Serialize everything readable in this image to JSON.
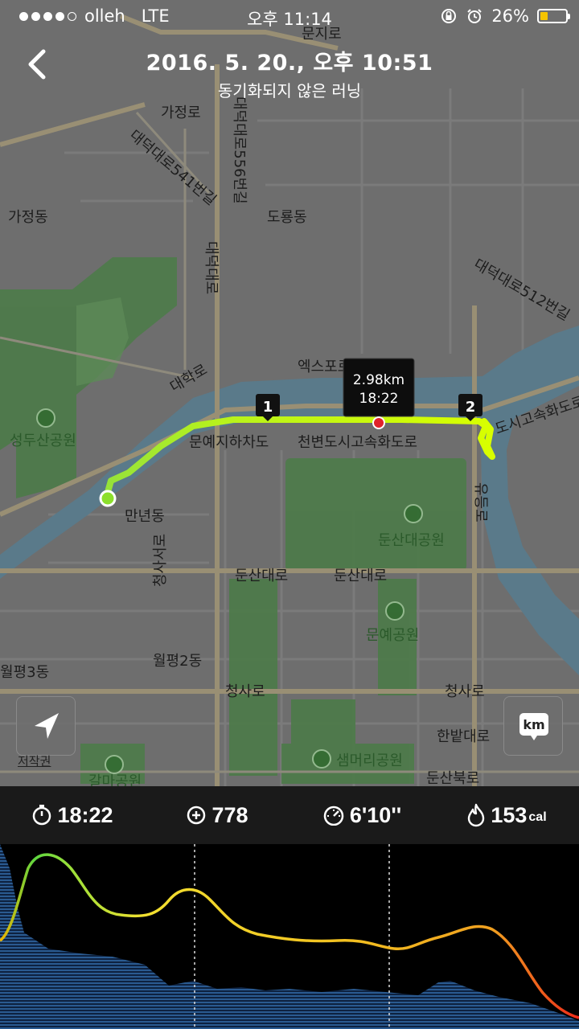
{
  "status_bar": {
    "carrier": "olleh",
    "network": "LTE",
    "time": "오후 11:14",
    "battery_percent": "26%",
    "signal_bars_filled": 4,
    "signal_bars_total": 5
  },
  "header": {
    "title": "2016. 5. 20., 오후 10:51",
    "subtitle": "동기화되지 않은 러닝"
  },
  "map": {
    "labels": {
      "munji": "문지로",
      "gajeong_ro": "가정로",
      "daedeok_556": "대덕대로556번길",
      "daedeok_541": "대덕대로541번길",
      "gajeong_dong": "가정동",
      "doryong_dong": "도룡동",
      "daedeok_ro": "대덕대로",
      "daedeok_512": "대덕대로512번길",
      "daehak_ro": "대학로",
      "expo": "엑스포로",
      "seongdusan": "성두산공원",
      "munye_underpass": "문예지하차도",
      "cheonbyeon": "천변도시고속화도로",
      "highway_right": "도시고속화도로",
      "mannyeon": "만년동",
      "dunsan_park": "둔산대공원",
      "yudeung": "유등로",
      "dunsan_ro_1": "둔산대로",
      "dunsan_ro_2": "둔산대로",
      "cheongsaseo": "청사서로",
      "munye_park": "문예공원",
      "wolpyeong3": "월평3동",
      "wolpyeong2": "월평2동",
      "cheongsa_ro_1": "청사로",
      "cheongsa_ro_2": "청사로",
      "hanbat": "한밭대로",
      "saemmeori": "샘머리공원",
      "dunsanbuk": "둔산북로",
      "galma": "갈마공원",
      "top_right": "문지로"
    },
    "markers": {
      "lap1": "1",
      "lap2": "2",
      "callout_distance": "2.98km",
      "callout_time": "18:22"
    },
    "copyright": "저작권",
    "unit_toggle": "km"
  },
  "stats": {
    "duration": "18:22",
    "elevation": "778",
    "pace": "6'10''",
    "calories": "153",
    "calories_unit": "cal"
  },
  "colors": {
    "route": "#c8ff00",
    "water": "#5d7c8b",
    "park": "#4f7a4c",
    "road": "#9a927c",
    "accent_red": "#e0222a",
    "start_green": "#8cdf2c"
  }
}
